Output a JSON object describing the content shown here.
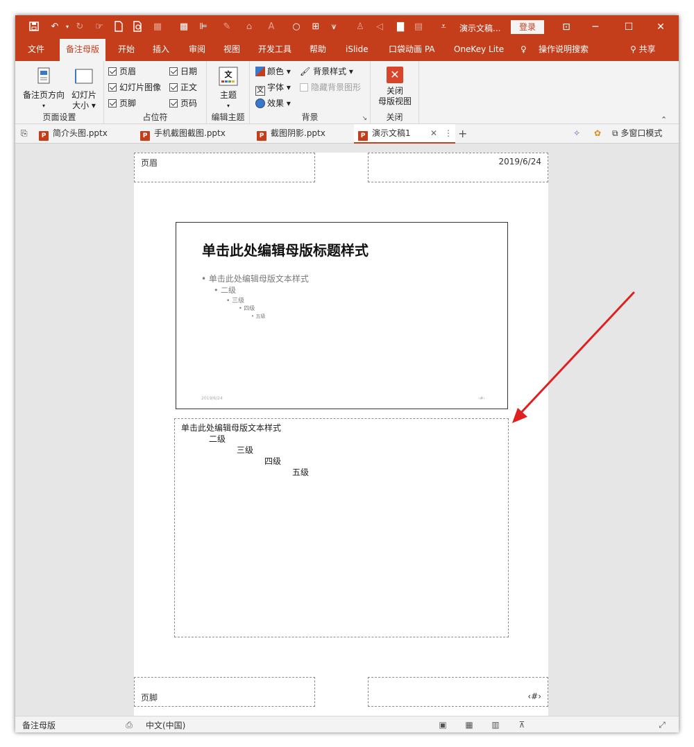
{
  "titlebar": {
    "doc_title": "演示文稿...",
    "login_label": "登录",
    "qa_icons": [
      "save-icon",
      "undo-icon",
      "redo-icon",
      "touch-mode-icon",
      "new-icon",
      "print-preview-icon",
      "image-icon",
      "grid-icon",
      "align-icon",
      "pen-icon",
      "highlight-icon",
      "font-color-icon",
      "shape-icon",
      "crop-icon",
      "brush-icon",
      "person-icon",
      "sound-icon",
      "layer-icon",
      "table-icon",
      "customize-icon"
    ]
  },
  "tabs": [
    "文件",
    "备注母版",
    "开始",
    "插入",
    "审阅",
    "视图",
    "开发工具",
    "帮助",
    "iSlide",
    "口袋动画 PA",
    "OneKey Lite",
    "操作说明搜索"
  ],
  "share_label": "共享",
  "ribbon": {
    "page_setup": {
      "orientation_label": "备注页方向",
      "slide_size_label_1": "幻灯片",
      "slide_size_label_2": "大小",
      "group_label": "页面设置"
    },
    "placeholders": {
      "header": "页眉",
      "slide_image": "幻灯片图像",
      "footer": "页脚",
      "date": "日期",
      "body": "正文",
      "page_number": "页码",
      "group_label": "占位符"
    },
    "edit_theme": {
      "theme_label": "主题",
      "group_label": "编辑主题"
    },
    "background": {
      "colors": "颜色",
      "fonts": "字体",
      "effects": "效果",
      "bg_style": "背景样式",
      "hide_bg": "隐藏背景图形",
      "group_label": "背景"
    },
    "close": {
      "label_1": "关闭",
      "label_2": "母版视图",
      "group_label": "关闭"
    }
  },
  "file_tabs": [
    "简介头图.pptx",
    "手机截图截图.pptx",
    "截图阴影.pptx",
    "演示文稿1"
  ],
  "file_tab_right": "多窗口模式",
  "page": {
    "header_text": "页眉",
    "date_text": "2019/6/24",
    "footer_text": "页脚",
    "slide_title": "单击此处编辑母版标题样式",
    "slide_levels": [
      "单击此处编辑母版文本样式",
      "二级",
      "三级",
      "四级",
      "五级"
    ],
    "slide_date": "2019/6/24",
    "slide_num": "‹#›",
    "notes_levels": [
      "单击此处编辑母版文本样式",
      "二级",
      "三级",
      "四级",
      "五级"
    ],
    "page_num": "‹#›"
  },
  "status": {
    "mode": "备注母版",
    "language": "中文(中国)"
  },
  "colors": {
    "accent": "#c43e1c",
    "arrow": "#e02020"
  }
}
